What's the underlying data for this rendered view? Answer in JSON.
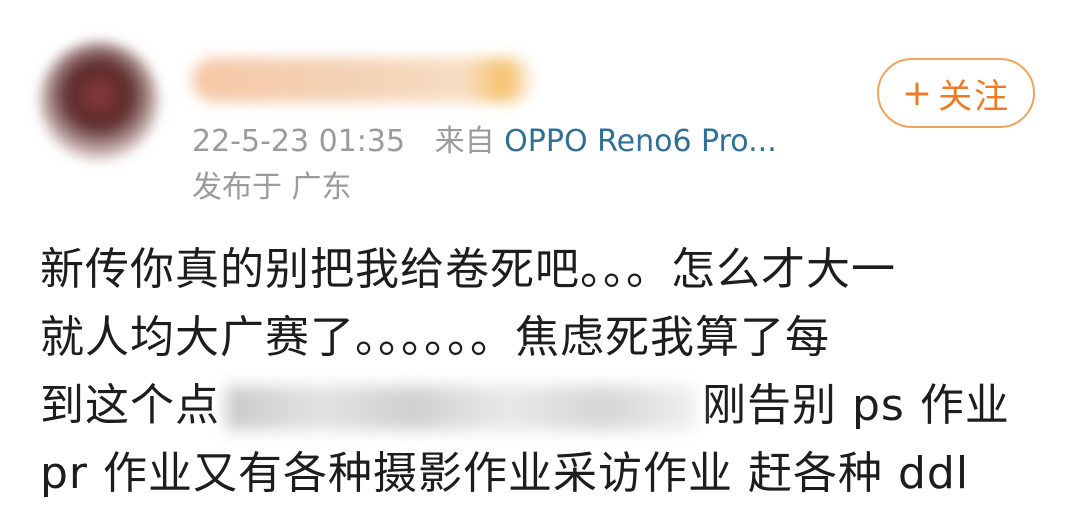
{
  "post": {
    "timestamp": "22-5-23 01:35",
    "source_prefix": "来自",
    "device": "OPPO Reno6 Pro...",
    "location": "发布于 广东",
    "follow_label": "关注",
    "follow_plus": "+",
    "content_lines": [
      "新传你真的别把我给卷死吧。。。怎么才大一",
      "就人均大广赛了。。。。。。焦虑死我算了每",
      "到这个点",
      "刚告别 ps 作业",
      "pr 作业又有各种摄影作业采访作业 赶各种 ddl"
    ]
  },
  "colors": {
    "accent": "#f07a22",
    "link": "#2f6f98",
    "muted": "#9b9b9b"
  }
}
